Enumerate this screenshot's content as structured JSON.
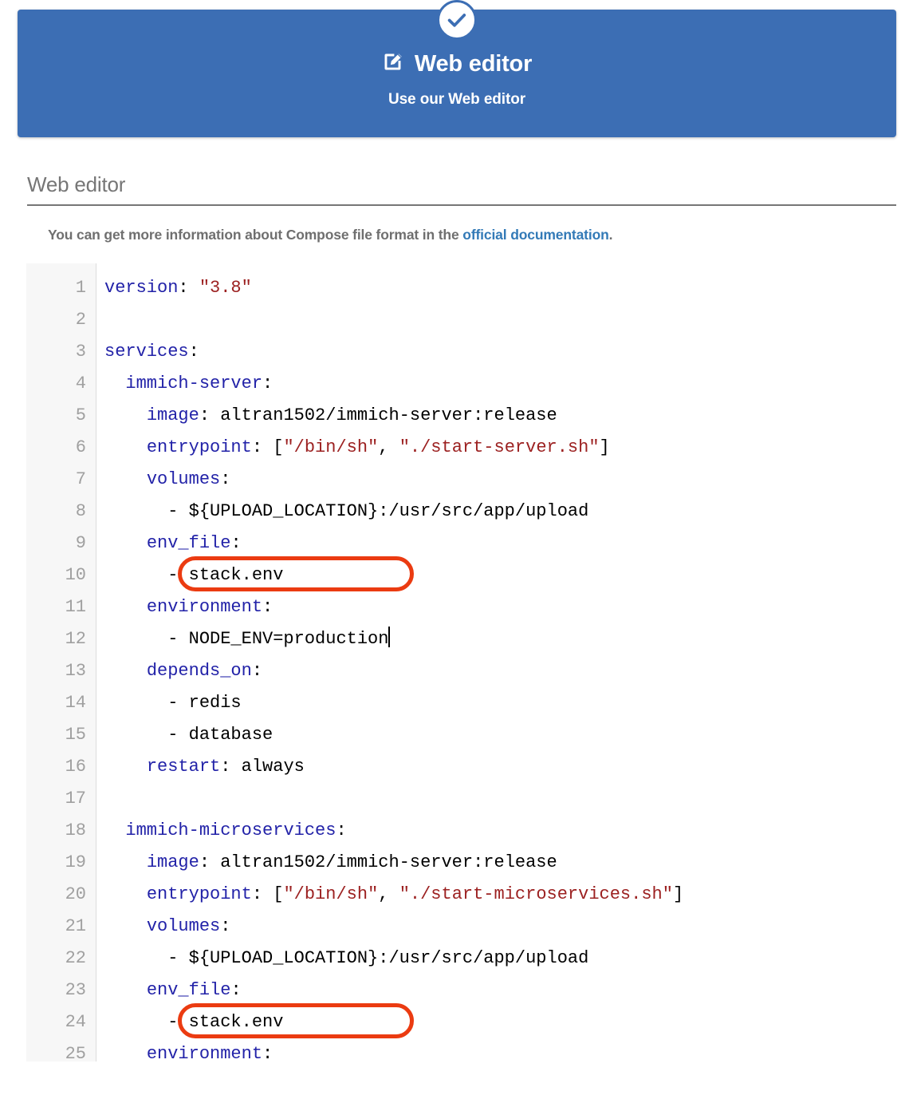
{
  "banner": {
    "status_icon": "check-circle-icon",
    "title_icon": "pen-to-square-icon",
    "title": "Web editor",
    "subtitle": "Use our Web editor"
  },
  "section": {
    "heading": "Web editor",
    "description_before": "You can get more information about Compose file format in the ",
    "description_link": "official documentation",
    "description_after": "."
  },
  "editor": {
    "language": "yaml",
    "cursor_line": 12,
    "line_numbers": [
      "1",
      "2",
      "3",
      "4",
      "5",
      "6",
      "7",
      "8",
      "9",
      "10",
      "11",
      "12",
      "13",
      "14",
      "15",
      "16",
      "17",
      "18",
      "19",
      "20",
      "21",
      "22",
      "23",
      "24",
      "25"
    ],
    "lines": [
      {
        "n": 1,
        "tokens": [
          {
            "t": "version",
            "c": "k"
          },
          {
            "t": ": ",
            "c": "p"
          },
          {
            "t": "\"3.8\"",
            "c": "s"
          }
        ]
      },
      {
        "n": 2,
        "tokens": []
      },
      {
        "n": 3,
        "tokens": [
          {
            "t": "services",
            "c": "k"
          },
          {
            "t": ":",
            "c": "p"
          }
        ]
      },
      {
        "n": 4,
        "tokens": [
          {
            "t": "  ",
            "c": "p"
          },
          {
            "t": "immich-server",
            "c": "k"
          },
          {
            "t": ":",
            "c": "p"
          }
        ]
      },
      {
        "n": 5,
        "tokens": [
          {
            "t": "    ",
            "c": "p"
          },
          {
            "t": "image",
            "c": "k"
          },
          {
            "t": ": altran1502/immich-server:release",
            "c": "p"
          }
        ]
      },
      {
        "n": 6,
        "tokens": [
          {
            "t": "    ",
            "c": "p"
          },
          {
            "t": "entrypoint",
            "c": "k"
          },
          {
            "t": ": [",
            "c": "p"
          },
          {
            "t": "\"/bin/sh\"",
            "c": "s"
          },
          {
            "t": ", ",
            "c": "p"
          },
          {
            "t": "\"./start-server.sh\"",
            "c": "s"
          },
          {
            "t": "]",
            "c": "p"
          }
        ]
      },
      {
        "n": 7,
        "tokens": [
          {
            "t": "    ",
            "c": "p"
          },
          {
            "t": "volumes",
            "c": "k"
          },
          {
            "t": ":",
            "c": "p"
          }
        ]
      },
      {
        "n": 8,
        "tokens": [
          {
            "t": "      - ${UPLOAD_LOCATION}:/usr/src/app/upload",
            "c": "p"
          }
        ]
      },
      {
        "n": 9,
        "tokens": [
          {
            "t": "    ",
            "c": "p"
          },
          {
            "t": "env_file",
            "c": "k"
          },
          {
            "t": ":",
            "c": "p"
          }
        ]
      },
      {
        "n": 10,
        "tokens": [
          {
            "t": "      - stack.env",
            "c": "p"
          }
        ]
      },
      {
        "n": 11,
        "tokens": [
          {
            "t": "    ",
            "c": "p"
          },
          {
            "t": "environment",
            "c": "k"
          },
          {
            "t": ":",
            "c": "p"
          }
        ]
      },
      {
        "n": 12,
        "tokens": [
          {
            "t": "      - NODE_ENV=production",
            "c": "p"
          }
        ]
      },
      {
        "n": 13,
        "tokens": [
          {
            "t": "    ",
            "c": "p"
          },
          {
            "t": "depends_on",
            "c": "k"
          },
          {
            "t": ":",
            "c": "p"
          }
        ]
      },
      {
        "n": 14,
        "tokens": [
          {
            "t": "      - redis",
            "c": "p"
          }
        ]
      },
      {
        "n": 15,
        "tokens": [
          {
            "t": "      - database",
            "c": "p"
          }
        ]
      },
      {
        "n": 16,
        "tokens": [
          {
            "t": "    ",
            "c": "p"
          },
          {
            "t": "restart",
            "c": "k"
          },
          {
            "t": ": always",
            "c": "p"
          }
        ]
      },
      {
        "n": 17,
        "tokens": []
      },
      {
        "n": 18,
        "tokens": [
          {
            "t": "  ",
            "c": "p"
          },
          {
            "t": "immich-microservices",
            "c": "k"
          },
          {
            "t": ":",
            "c": "p"
          }
        ]
      },
      {
        "n": 19,
        "tokens": [
          {
            "t": "    ",
            "c": "p"
          },
          {
            "t": "image",
            "c": "k"
          },
          {
            "t": ": altran1502/immich-server:release",
            "c": "p"
          }
        ]
      },
      {
        "n": 20,
        "tokens": [
          {
            "t": "    ",
            "c": "p"
          },
          {
            "t": "entrypoint",
            "c": "k"
          },
          {
            "t": ": [",
            "c": "p"
          },
          {
            "t": "\"/bin/sh\"",
            "c": "s"
          },
          {
            "t": ", ",
            "c": "p"
          },
          {
            "t": "\"./start-microservices.sh\"",
            "c": "s"
          },
          {
            "t": "]",
            "c": "p"
          }
        ]
      },
      {
        "n": 21,
        "tokens": [
          {
            "t": "    ",
            "c": "p"
          },
          {
            "t": "volumes",
            "c": "k"
          },
          {
            "t": ":",
            "c": "p"
          }
        ]
      },
      {
        "n": 22,
        "tokens": [
          {
            "t": "      - ${UPLOAD_LOCATION}:/usr/src/app/upload",
            "c": "p"
          }
        ]
      },
      {
        "n": 23,
        "tokens": [
          {
            "t": "    ",
            "c": "p"
          },
          {
            "t": "env_file",
            "c": "k"
          },
          {
            "t": ":",
            "c": "p"
          }
        ]
      },
      {
        "n": 24,
        "tokens": [
          {
            "t": "      - stack.env",
            "c": "p"
          }
        ]
      },
      {
        "n": 25,
        "tokens": [
          {
            "t": "    ",
            "c": "p"
          },
          {
            "t": "environment",
            "c": "k"
          },
          {
            "t": ":",
            "c": "p"
          }
        ]
      }
    ]
  },
  "annotations": [
    {
      "id": "anno-1",
      "shape": "oval",
      "target_line": 10,
      "target_text": "- stack.env",
      "color": "#eb3b11"
    },
    {
      "id": "anno-2",
      "shape": "oval",
      "target_line": 24,
      "target_text": "- stack.env",
      "color": "#eb3b11"
    }
  ],
  "colors": {
    "banner_bg": "#3c6eb4",
    "link": "#337ab7",
    "yaml_key": "#2222a8",
    "yaml_string": "#9c2121",
    "annotation": "#eb3b11",
    "muted_text": "#6f6f6f"
  }
}
